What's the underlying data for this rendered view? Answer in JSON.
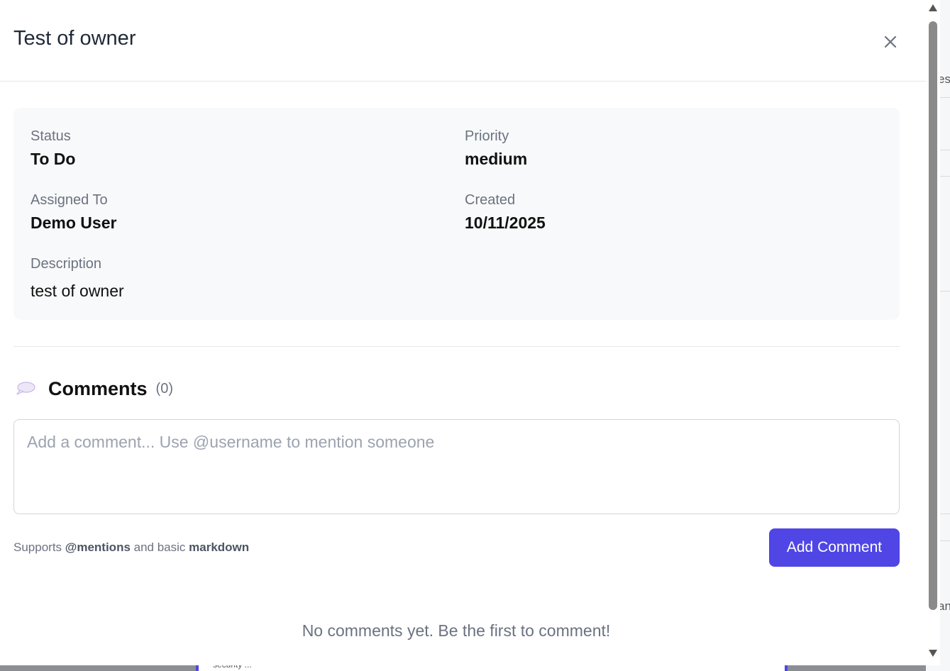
{
  "modal": {
    "title": "Test of owner",
    "close_icon": "close-icon"
  },
  "details": {
    "status_label": "Status",
    "status_value": "To Do",
    "priority_label": "Priority",
    "priority_value": "medium",
    "assigned_label": "Assigned To",
    "assigned_value": "Demo User",
    "created_label": "Created",
    "created_value": "10/11/2025",
    "description_label": "Description",
    "description_value": "test of owner"
  },
  "comments": {
    "icon": "speech-bubble-icon",
    "title": "Comments",
    "count": "(0)",
    "placeholder": "Add a comment... Use @username to mention someone",
    "hint_prefix": "Supports ",
    "hint_mentions": "@mentions",
    "hint_middle": " and basic ",
    "hint_markdown": "markdown",
    "add_button": "Add Comment",
    "empty_message": "No comments yet. Be the first to comment!"
  },
  "background": {
    "fragment_top": "es",
    "fragment_bottom": "an",
    "card_text": "security ..."
  },
  "colors": {
    "accent": "#4f46e5",
    "panel_bg": "#f8f9fa",
    "muted_text": "#6b7280"
  }
}
